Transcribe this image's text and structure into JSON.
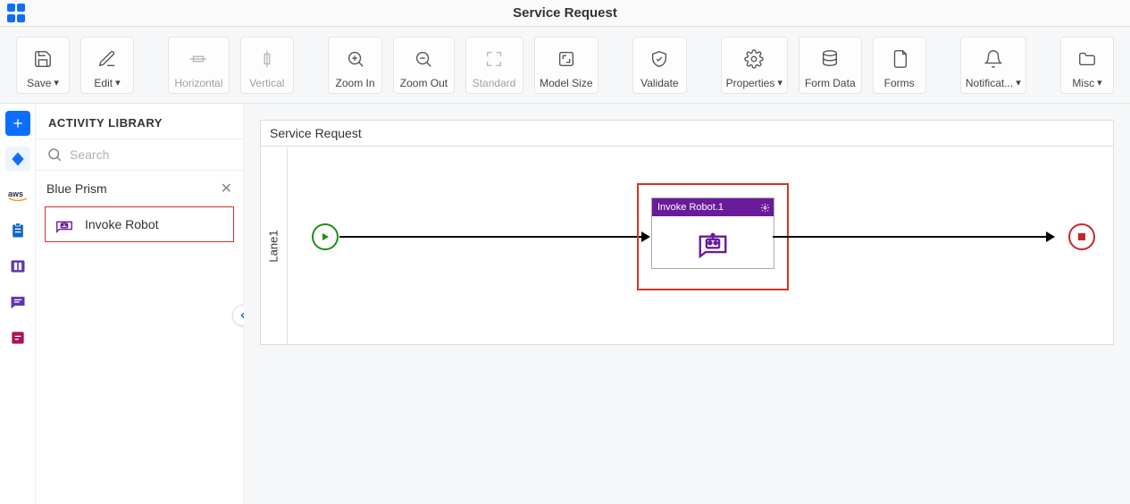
{
  "header": {
    "title": "Service Request"
  },
  "toolbar": {
    "save": "Save",
    "edit": "Edit",
    "horizontal": "Horizontal",
    "vertical": "Vertical",
    "zoom_in": "Zoom In",
    "zoom_out": "Zoom Out",
    "standard": "Standard",
    "model_size": "Model Size",
    "validate": "Validate",
    "properties": "Properties",
    "form_data": "Form Data",
    "forms": "Forms",
    "notifications": "Notificat...",
    "misc": "Misc"
  },
  "library": {
    "header": "ACTIVITY LIBRARY",
    "search_placeholder": "Search",
    "section": "Blue Prism",
    "item_invoke_robot": "Invoke Robot"
  },
  "canvas": {
    "title": "Service Request",
    "lane": "Lane1",
    "activity_title": "Invoke Robot.1"
  }
}
